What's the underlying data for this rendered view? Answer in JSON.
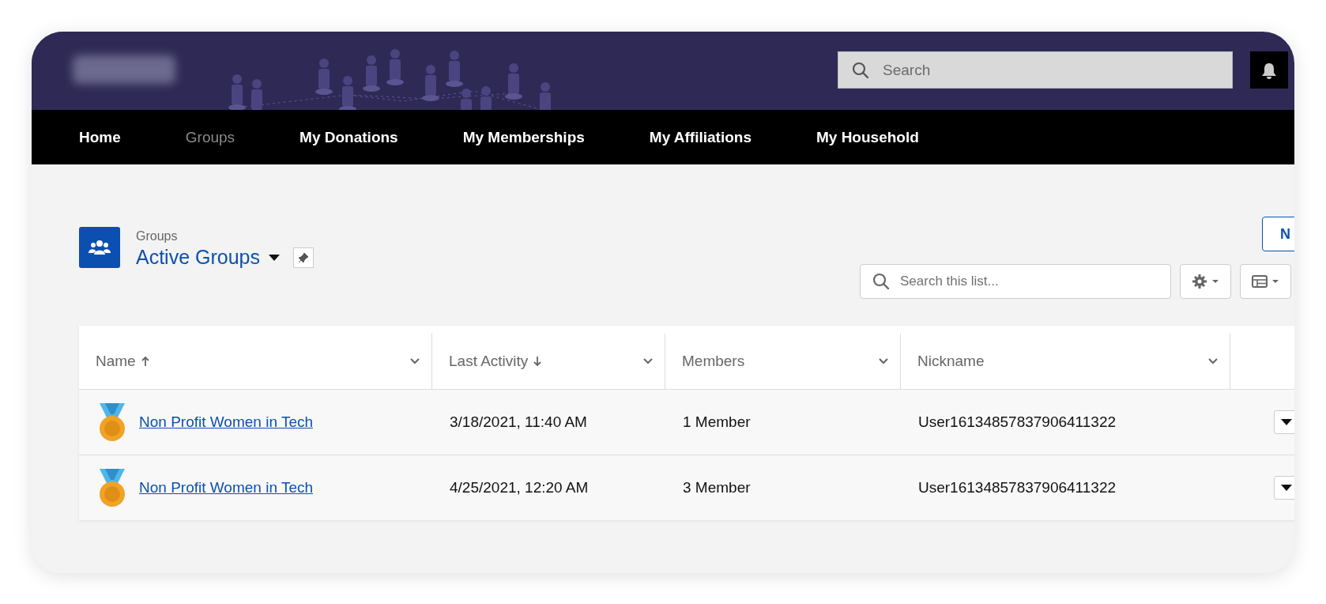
{
  "header": {
    "search": {
      "placeholder": "Search"
    }
  },
  "nav": [
    {
      "label": "Home",
      "selected": false
    },
    {
      "label": "Groups",
      "selected": true
    },
    {
      "label": "My Donations",
      "selected": false
    },
    {
      "label": "My Memberships",
      "selected": false
    },
    {
      "label": "My Affiliations",
      "selected": false
    },
    {
      "label": "My Household",
      "selected": false
    }
  ],
  "list_view": {
    "object": "Groups",
    "title": "Active Groups",
    "new_button": "N",
    "search": {
      "placeholder": "Search this list..."
    }
  },
  "table": {
    "columns": [
      {
        "label": "Name",
        "kind": "ascending"
      },
      {
        "label": "Last Activity",
        "kind": "descending"
      },
      {
        "label": "Members",
        "kind": "plain"
      },
      {
        "label": "Nickname",
        "kind": "plain"
      }
    ],
    "rows": [
      {
        "name": "Non Profit Women in Tech",
        "last_activity": "3/18/2021, 11:40 AM",
        "members": "1 Member",
        "nickname": "User16134857837906411322"
      },
      {
        "name": "Non Profit Women in Tech",
        "last_activity": "4/25/2021, 12:20 AM",
        "members": "3 Member",
        "nickname": "User16134857837906411322"
      }
    ]
  }
}
